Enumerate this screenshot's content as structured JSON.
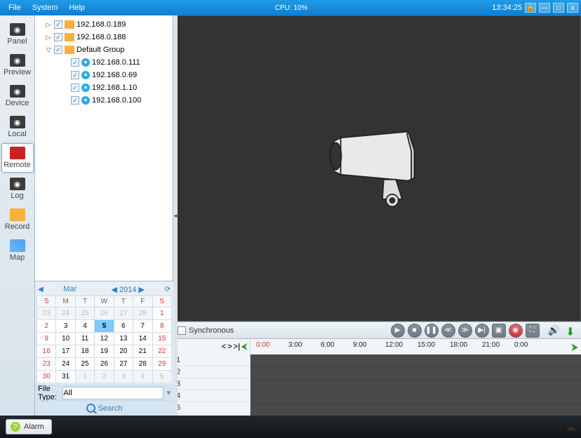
{
  "titlebar": {
    "menus": [
      "File",
      "System",
      "Help"
    ],
    "cpu": "CPU: 10%",
    "time": "13:34:25"
  },
  "sidebar": {
    "items": [
      {
        "label": "Panel",
        "key": "panel",
        "ico": "dark"
      },
      {
        "label": "Preview",
        "key": "preview",
        "ico": "dark"
      },
      {
        "label": "Device",
        "key": "device",
        "ico": "dark"
      },
      {
        "label": "Local",
        "key": "local",
        "ico": "dark"
      },
      {
        "label": "Remote",
        "key": "remote",
        "ico": "remote",
        "active": true
      },
      {
        "label": "Log",
        "key": "log",
        "ico": "dark"
      },
      {
        "label": "Record",
        "key": "record",
        "ico": "folder"
      },
      {
        "label": "Map",
        "key": "map",
        "ico": "map"
      }
    ]
  },
  "tree": {
    "nodes": [
      {
        "indent": 1,
        "expander": "▷",
        "check": "✓",
        "folder": true,
        "label": "192.168.0.189"
      },
      {
        "indent": 1,
        "expander": "▷",
        "check": "✓",
        "folder": true,
        "label": "192.168.0.188"
      },
      {
        "indent": 1,
        "expander": "▽",
        "check": "✓",
        "folder": true,
        "label": "Default Group"
      },
      {
        "indent": 3,
        "expander": "",
        "check": "✓",
        "device": true,
        "label": "192.168.0.111"
      },
      {
        "indent": 3,
        "expander": "",
        "check": "✓",
        "device": true,
        "label": "192.168.0.69"
      },
      {
        "indent": 3,
        "expander": "",
        "check": "✓",
        "device": true,
        "label": "192.168.1.10"
      },
      {
        "indent": 3,
        "expander": "",
        "check": "✓",
        "device": true,
        "label": "192.168.0.100"
      }
    ]
  },
  "calendar": {
    "month": "Mar",
    "year": "2014",
    "dow": [
      "S",
      "M",
      "T",
      "W",
      "T",
      "F",
      "S"
    ],
    "grid": [
      [
        {
          "v": "23",
          "dim": true,
          "sun": true
        },
        {
          "v": "24",
          "dim": true
        },
        {
          "v": "25",
          "dim": true
        },
        {
          "v": "26",
          "dim": true
        },
        {
          "v": "27",
          "dim": true
        },
        {
          "v": "28",
          "dim": true
        },
        {
          "v": "1",
          "red": true
        }
      ],
      [
        {
          "v": "2",
          "red": true
        },
        {
          "v": "3"
        },
        {
          "v": "4"
        },
        {
          "v": "5",
          "sel": true
        },
        {
          "v": "6"
        },
        {
          "v": "7"
        },
        {
          "v": "8",
          "red": true
        }
      ],
      [
        {
          "v": "9",
          "red": true
        },
        {
          "v": "10"
        },
        {
          "v": "11"
        },
        {
          "v": "12"
        },
        {
          "v": "13"
        },
        {
          "v": "14"
        },
        {
          "v": "15",
          "red": true
        }
      ],
      [
        {
          "v": "16",
          "red": true
        },
        {
          "v": "17"
        },
        {
          "v": "18"
        },
        {
          "v": "19"
        },
        {
          "v": "20"
        },
        {
          "v": "21"
        },
        {
          "v": "22",
          "red": true
        }
      ],
      [
        {
          "v": "23",
          "red": true
        },
        {
          "v": "24"
        },
        {
          "v": "25"
        },
        {
          "v": "26"
        },
        {
          "v": "27"
        },
        {
          "v": "28"
        },
        {
          "v": "29",
          "red": true
        }
      ],
      [
        {
          "v": "30",
          "red": true
        },
        {
          "v": "31"
        },
        {
          "v": "1",
          "dim": true
        },
        {
          "v": "2",
          "dim": true
        },
        {
          "v": "3",
          "dim": true
        },
        {
          "v": "4",
          "dim": true
        },
        {
          "v": "5",
          "dim": true
        }
      ]
    ]
  },
  "filetype": {
    "label": "File Type:",
    "value": "All"
  },
  "search_label": "Search",
  "sync_label": "Synchronous",
  "timeline": {
    "ticks": [
      "0:00",
      "3:00",
      "6:00",
      "9:00",
      "12:00",
      "15:00",
      "18:00",
      "21:00",
      "0:00"
    ],
    "channels": [
      "1",
      "2",
      "3",
      "4",
      "5"
    ]
  },
  "alarm_label": "Alarm"
}
